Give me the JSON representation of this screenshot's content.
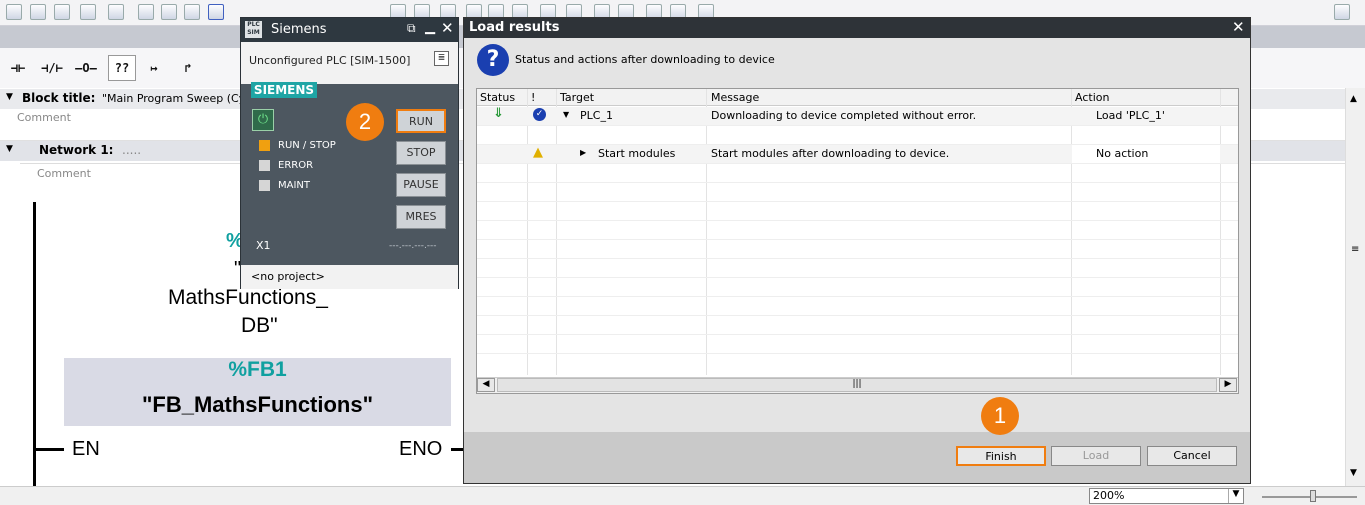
{
  "block_title_label": "Block title:",
  "block_title_value": "\"Main Program Sweep (Cy",
  "comment_label": "Comment",
  "network_label": "Network 1:",
  "network_dots": ".....",
  "network_comment": "Comment",
  "db_pct": "%",
  "db_quote": "\"",
  "db_line1": "MathsFunctions_",
  "db_line2": "DB\"",
  "fb_number": "%FB1",
  "fb_name": "\"FB_MathsFunctions\"",
  "en_label": "EN",
  "eno_label": "ENO",
  "ladder_tools": [
    "⊣⊢",
    "⊣/⊢",
    "–O–",
    "??",
    "↦",
    "↱"
  ],
  "zoom_value": "200%",
  "plcsim": {
    "title": "Siemens",
    "icon_label": "PLC SIM",
    "subtitle": "Unconfigured PLC [SIM-1500]",
    "brand": "SIEMENS",
    "leds": [
      {
        "label": "RUN / STOP",
        "color": "#f0a010"
      },
      {
        "label": "ERROR",
        "color": "#d6d6d6"
      },
      {
        "label": "MAINT",
        "color": "#d6d6d6"
      }
    ],
    "buttons": {
      "run": "RUN",
      "stop": "STOP",
      "pause": "PAUSE",
      "mres": "MRES"
    },
    "x1": "X1",
    "ip": "---.---.---.---",
    "footer": "<no project>"
  },
  "dialog": {
    "title": "Load results",
    "heading": "Status and actions after downloading to device",
    "columns": [
      "Status",
      "!",
      "Target",
      "Message",
      "Action"
    ],
    "rows": [
      {
        "target": "PLC_1",
        "message": "Downloading to device completed without error.",
        "action": "Load 'PLC_1'"
      },
      {
        "target": "Start modules",
        "message": "Start modules after downloading to device.",
        "action": "No action"
      }
    ],
    "buttons": {
      "finish": "Finish",
      "load": "Load",
      "cancel": "Cancel"
    }
  },
  "badges": {
    "one": "1",
    "two": "2"
  },
  "colors": {
    "accent_orange": "#f07d10",
    "fb_teal": "#10a0a0",
    "siemens_teal": "#1fa5a5"
  }
}
